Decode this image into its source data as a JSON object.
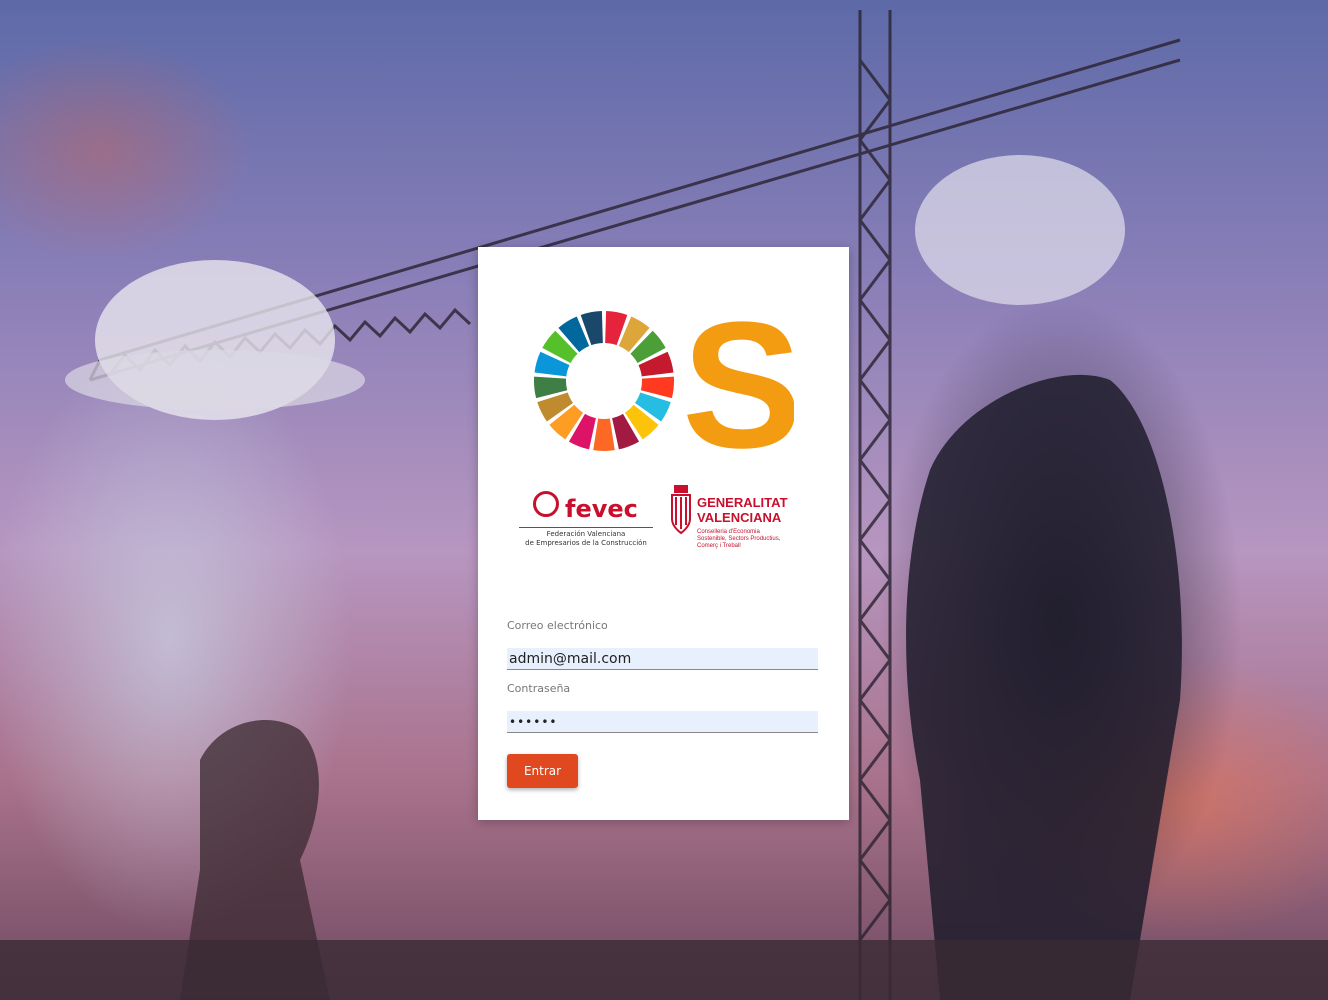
{
  "background": {
    "description_icon": "construction-workers-crane-photo"
  },
  "logos": {
    "ods": {
      "letter": "S",
      "ring_colors": [
        "#e5243b",
        "#dda63a",
        "#4c9f38",
        "#c5192d",
        "#ff3a21",
        "#26bde2",
        "#fcc30b",
        "#a21942",
        "#fd6925",
        "#dd1367",
        "#fd9d24",
        "#bf8b2e",
        "#3f7e44",
        "#0a97d9",
        "#56c02b",
        "#00689d",
        "#19486a"
      ],
      "s_color": "#f39c12"
    },
    "fevec": {
      "name": "fevec",
      "subtitle_line1": "Federación Valenciana",
      "subtitle_line2": "de Empresarios de la Construcción"
    },
    "gva": {
      "title_line1": "GENERALITAT",
      "title_line2": "VALENCIANA",
      "sub_line1": "Conselleria d'Economia",
      "sub_line2": "Sostenible, Sectors Productius,",
      "sub_line3": "Comerç i Treball"
    }
  },
  "form": {
    "email_label": "Correo electrónico",
    "email_value": "admin@mail.com",
    "password_label": "Contraseña",
    "password_value": "••••••",
    "submit_label": "Entrar"
  },
  "colors": {
    "accent": "#e0491f",
    "brand_red": "#c8102e"
  }
}
